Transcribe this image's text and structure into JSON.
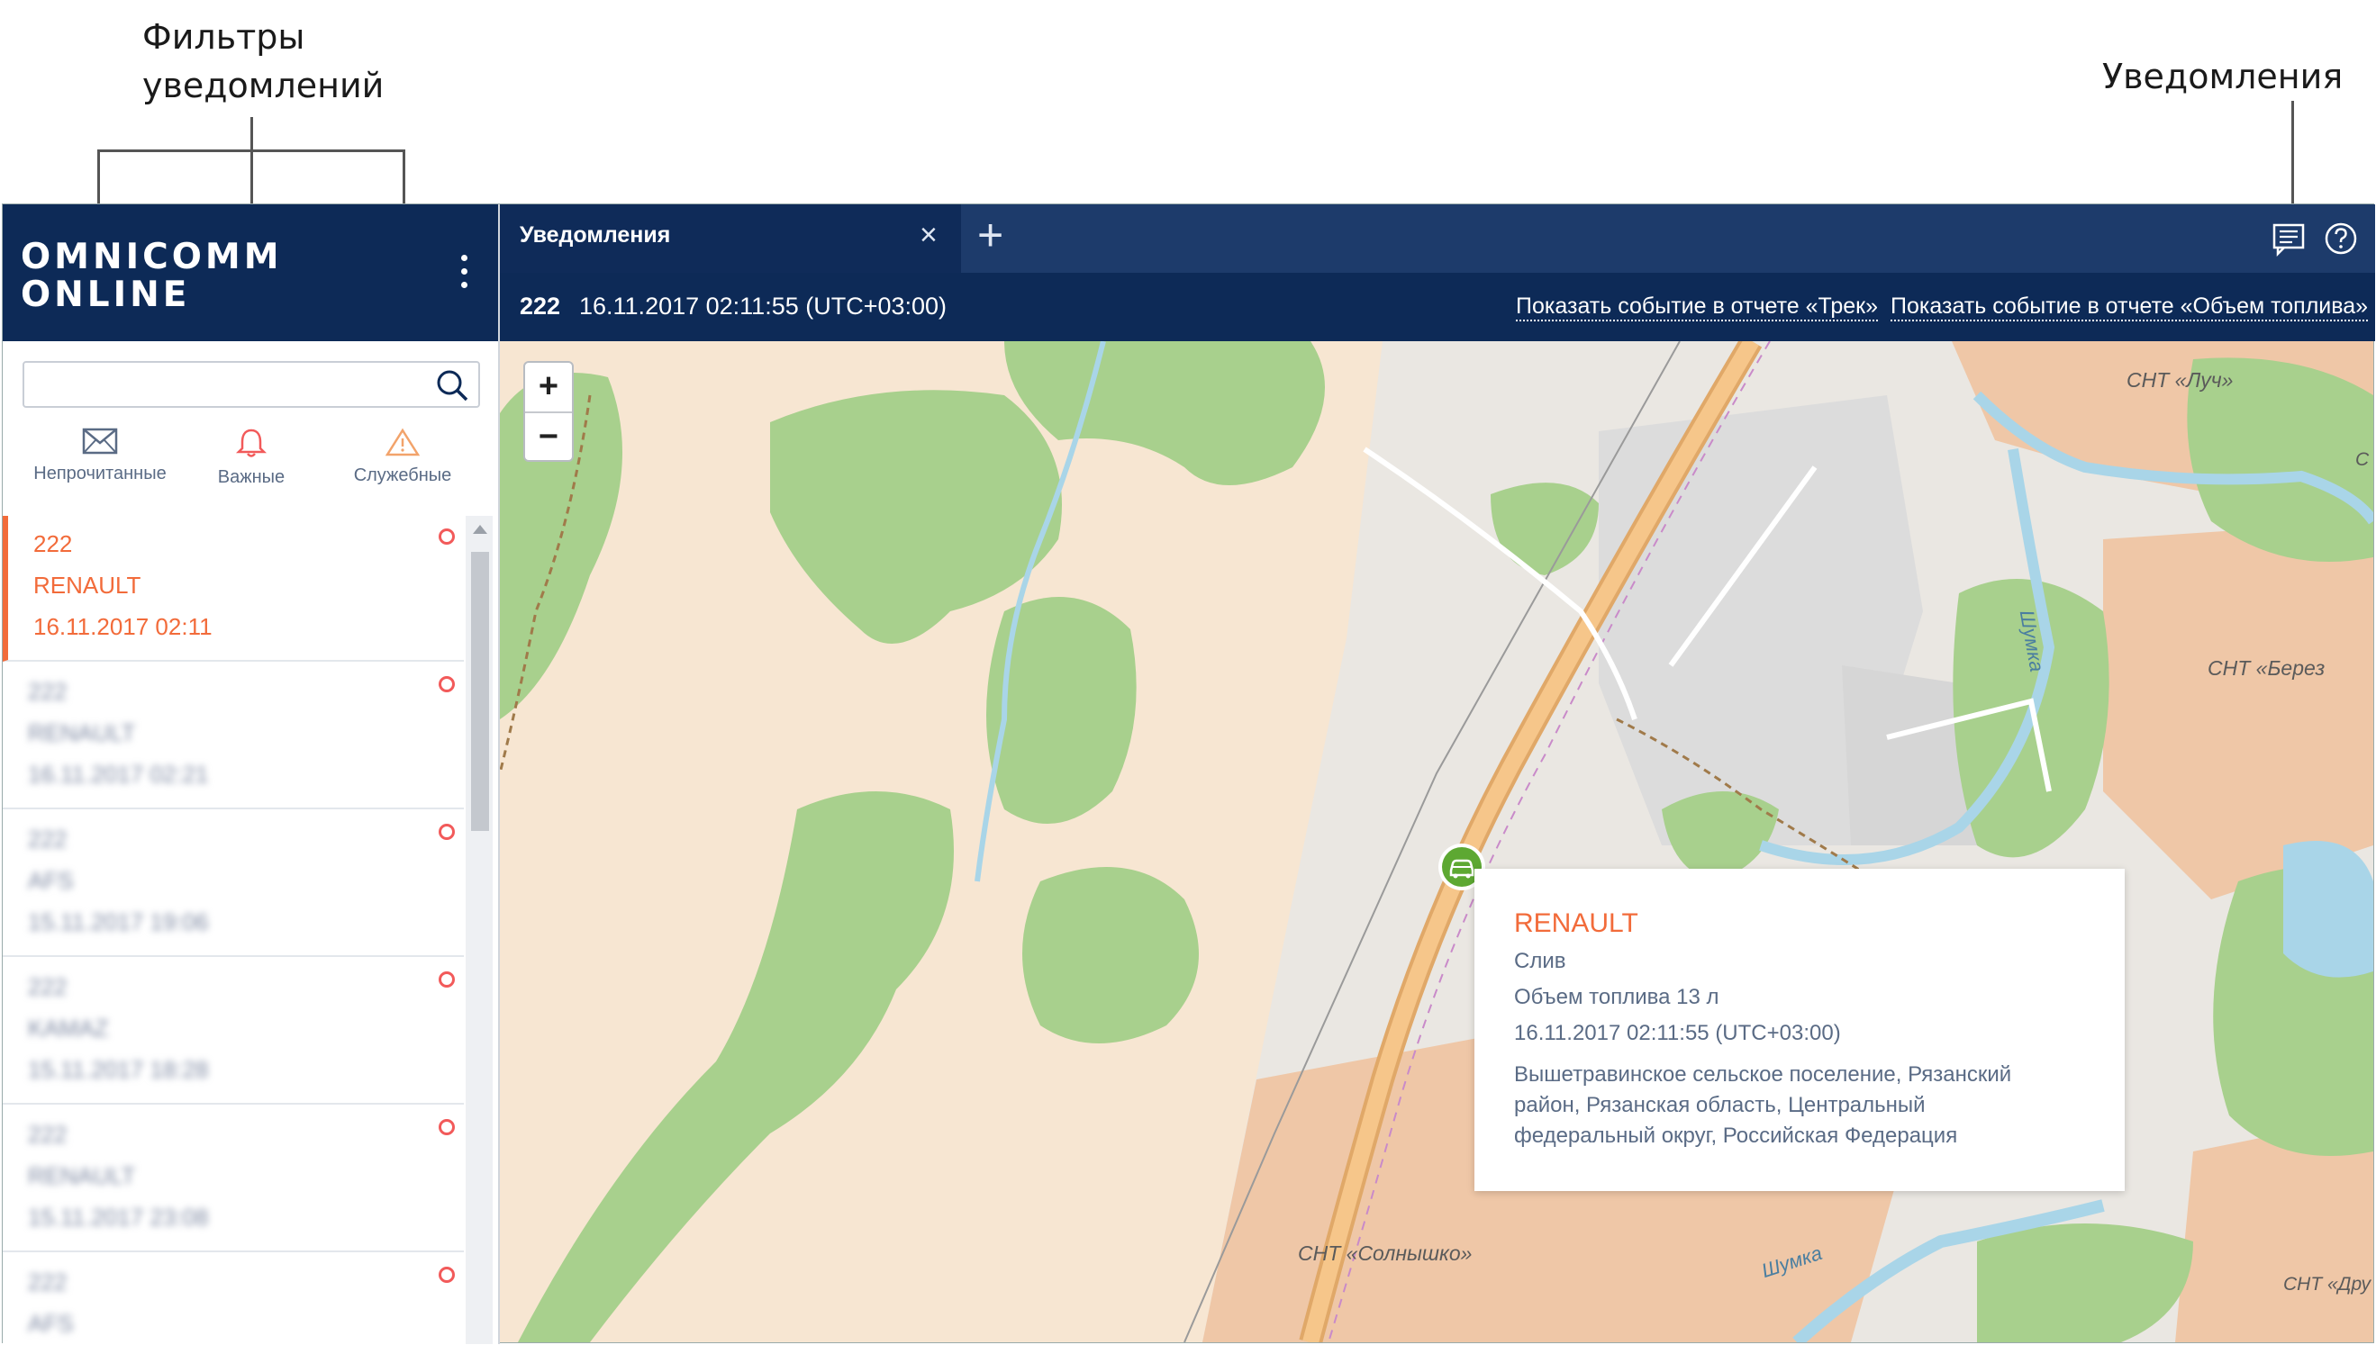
{
  "callouts": {
    "filters": "Фильтры\nуведомлений",
    "filters_line1": "Фильтры",
    "filters_line2": "уведомлений",
    "notifications": "Уведомления"
  },
  "logo": {
    "line1": "OMNICOMM",
    "line2": "ONLINE"
  },
  "search": {
    "value": "",
    "icon": "search-icon"
  },
  "filters": [
    {
      "label": "Непрочитанные",
      "icon": "envelope-icon",
      "color": "#5a6b85"
    },
    {
      "label": "Важные",
      "icon": "bell-icon",
      "color": "#f25a5a"
    },
    {
      "label": "Служебные",
      "icon": "warning-icon",
      "color": "#f2a36b"
    }
  ],
  "notifications": [
    {
      "object": "222",
      "vehicle": "RENAULT",
      "time": "16.11.2017 02:11",
      "active": true
    },
    {
      "object": "222",
      "vehicle": "RENAULT",
      "time": "16.11.2017 02:21",
      "active": false
    },
    {
      "object": "222",
      "vehicle": "AFS",
      "time": "15.11.2017 19:06",
      "active": false
    },
    {
      "object": "222",
      "vehicle": "KAMAZ",
      "time": "15.11.2017 18:28",
      "active": false
    },
    {
      "object": "222",
      "vehicle": "RENAULT",
      "time": "15.11.2017 23:08",
      "active": false
    },
    {
      "object": "222",
      "vehicle": "AFS",
      "time": "",
      "active": false
    }
  ],
  "tabs": [
    {
      "label": "Уведомления",
      "close": "×"
    }
  ],
  "tab_add": "+",
  "toolbar_icons": [
    "notifications-icon",
    "help-icon"
  ],
  "event": {
    "object": "222",
    "time": "16.11.2017 02:11:55 (UTC+03:00)",
    "link_track": "Показать событие в отчете «Трек»",
    "link_fuel": "Показать событие в отчете «Объем топлива»"
  },
  "map": {
    "zoom_in": "+",
    "zoom_out": "−",
    "labels": {
      "snt_luch": "СНТ «Луч»",
      "snt_berez": "СНТ «Берез",
      "snt_sun": "СНТ «Солнышко»",
      "snt_dru": "СНТ «Дру",
      "shumka1": "Шумка",
      "shumka2": "Шумка",
      "edge_c": "С"
    },
    "marker_icon": "car-icon"
  },
  "popup": {
    "title": "RENAULT",
    "event_type": "Слив",
    "fuel": "Объем топлива 13 л",
    "time": "16.11.2017 02:11:55 (UTC+03:00)",
    "address1": "Вышетравинское сельское поселение, Рязанский",
    "address2": "район, Рязанская область, Центральный",
    "address3": "федеральный округ, Российская Федерация"
  },
  "colors": {
    "header": "#0d2a57",
    "accent": "#f26b3a",
    "forest": "#a8d08d",
    "field": "#f7e6d2",
    "orange_zone": "#efc7a7",
    "water": "#a9d5e8",
    "road": "#f6c68a"
  }
}
